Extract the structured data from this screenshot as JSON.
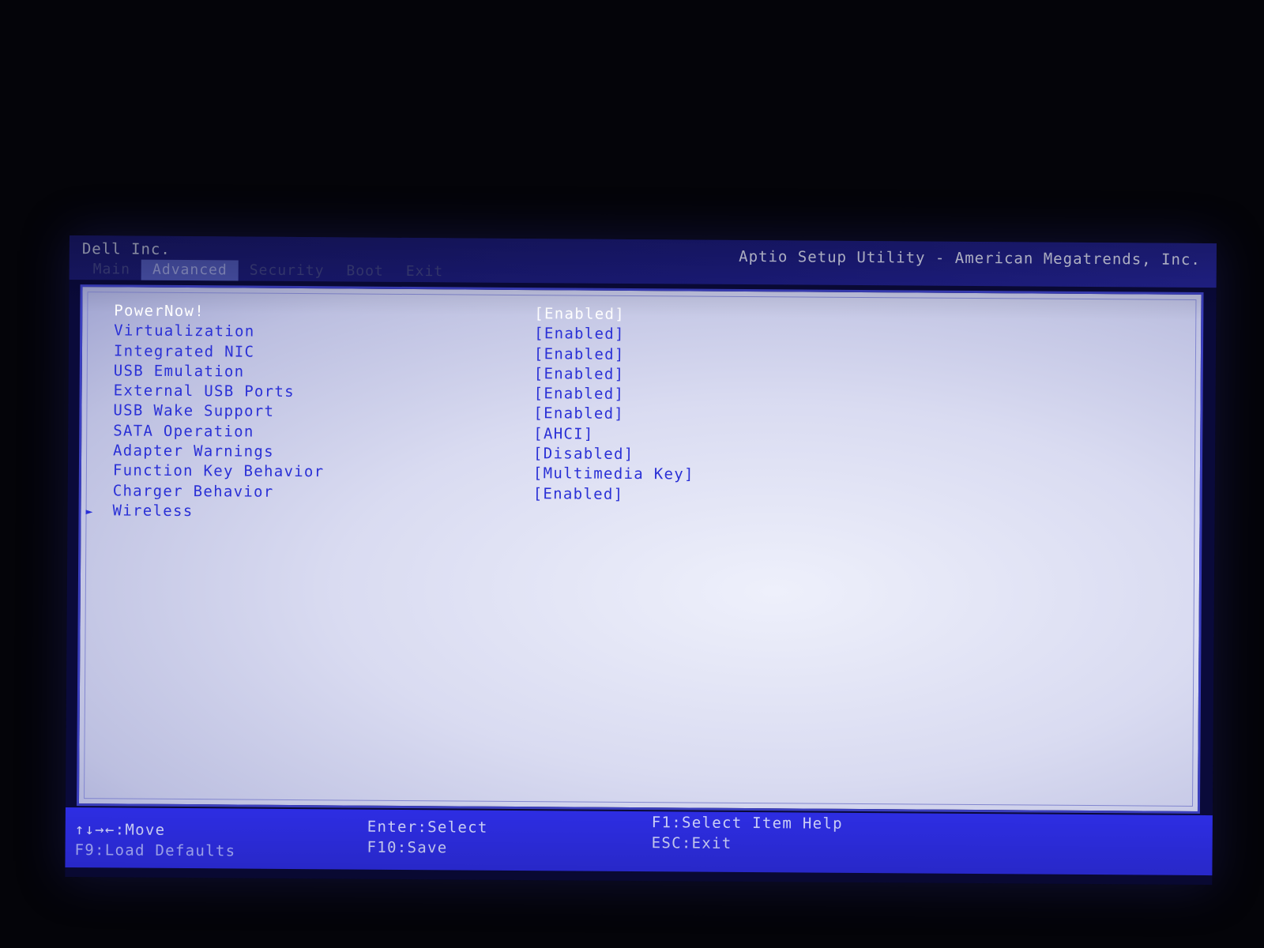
{
  "header": {
    "vendor": "Dell Inc.",
    "utility_title": "Aptio Setup Utility - American Megatrends, Inc.",
    "tabs": [
      {
        "label": "Main"
      },
      {
        "label": "Advanced",
        "active": true
      },
      {
        "label": "Security"
      },
      {
        "label": "Boot"
      },
      {
        "label": "Exit"
      }
    ]
  },
  "settings": [
    {
      "label": "PowerNow!",
      "value": "[Enabled]",
      "selected": true
    },
    {
      "label": "Virtualization",
      "value": "[Enabled]"
    },
    {
      "label": "Integrated NIC",
      "value": "[Enabled]"
    },
    {
      "label": "USB Emulation",
      "value": "[Enabled]"
    },
    {
      "label": "External USB Ports",
      "value": "[Enabled]"
    },
    {
      "label": "USB Wake Support",
      "value": "[Enabled]"
    },
    {
      "label": "SATA Operation",
      "value": "[AHCI]"
    },
    {
      "label": "Adapter Warnings",
      "value": "[Disabled]"
    },
    {
      "label": "Function Key Behavior",
      "value": "[Multimedia Key]"
    },
    {
      "label": "Charger Behavior",
      "value": "[Enabled]"
    },
    {
      "label": "Wireless",
      "submenu_marker": "►"
    }
  ],
  "footer": {
    "move": "↑↓→←:Move",
    "load_defaults": "F9:Load Defaults",
    "enter_select": "Enter:Select",
    "f10_save": "F10:Save",
    "f1_help": "F1:Select Item Help",
    "esc_exit": "ESC:Exit"
  },
  "colors": {
    "header_bg": "#1c1c80",
    "footer_bg": "#2e2ee6",
    "item_text": "#2a30d6",
    "selected_text": "#ffffff",
    "panel_bg": "#d9dbf1"
  }
}
